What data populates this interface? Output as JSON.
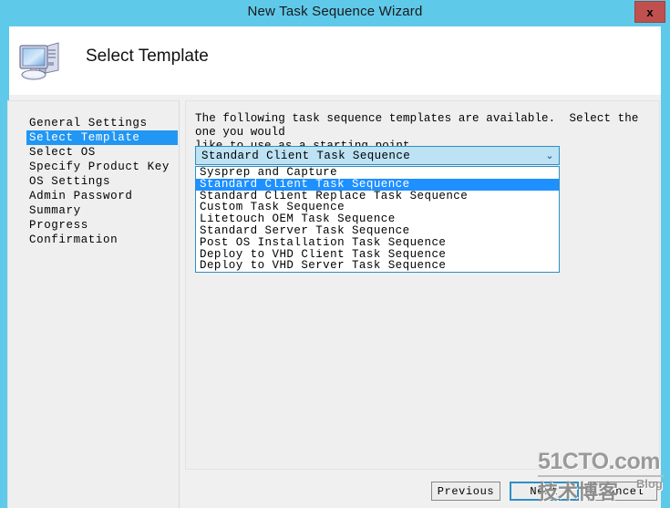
{
  "window": {
    "title": "New Task Sequence Wizard",
    "close_label": "x",
    "accent_titlebar": "#5FC9EA",
    "close_button_color": "#C0504D"
  },
  "header": {
    "page_title": "Select Template",
    "icon": "computer-icon"
  },
  "sidebar": {
    "items": [
      {
        "label": "General Settings",
        "selected": false
      },
      {
        "label": "Select Template",
        "selected": true
      },
      {
        "label": "Select OS",
        "selected": false
      },
      {
        "label": "Specify Product Key",
        "selected": false
      },
      {
        "label": "OS Settings",
        "selected": false
      },
      {
        "label": "Admin Password",
        "selected": false
      },
      {
        "label": "Summary",
        "selected": false
      },
      {
        "label": "Progress",
        "selected": false
      },
      {
        "label": "Confirmation",
        "selected": false
      }
    ],
    "selected_highlight_color": "#2196F3"
  },
  "main": {
    "description": "The following task sequence templates are available.  Select the one you would\nlike to use as a starting point.",
    "combo": {
      "value": "Standard Client Task Sequence",
      "arrow_icon": "chevron-down-icon",
      "arrow_glyph": "⌄",
      "background": "#BCE2F4",
      "border": "#2E8FC4"
    },
    "dropdown": {
      "open": true,
      "highlight_color": "#1E90FF",
      "options": [
        {
          "label": "Sysprep and Capture",
          "selected": false
        },
        {
          "label": "Standard Client Task Sequence",
          "selected": true
        },
        {
          "label": "Standard Client Replace Task Sequence",
          "selected": false
        },
        {
          "label": "Custom Task Sequence",
          "selected": false
        },
        {
          "label": "Litetouch OEM Task Sequence",
          "selected": false
        },
        {
          "label": "Standard Server Task Sequence",
          "selected": false
        },
        {
          "label": "Post OS Installation Task Sequence",
          "selected": false
        },
        {
          "label": "Deploy to VHD Client Task Sequence",
          "selected": false
        },
        {
          "label": "Deploy to VHD Server Task Sequence",
          "selected": false
        }
      ]
    }
  },
  "footer": {
    "previous_label": "Previous",
    "next_label": "Next",
    "cancel_label": "Cancel",
    "focused_button": "Next"
  },
  "watermark": {
    "top": "51CTO.com",
    "chinese": "技术博客",
    "blog": "Blog"
  }
}
